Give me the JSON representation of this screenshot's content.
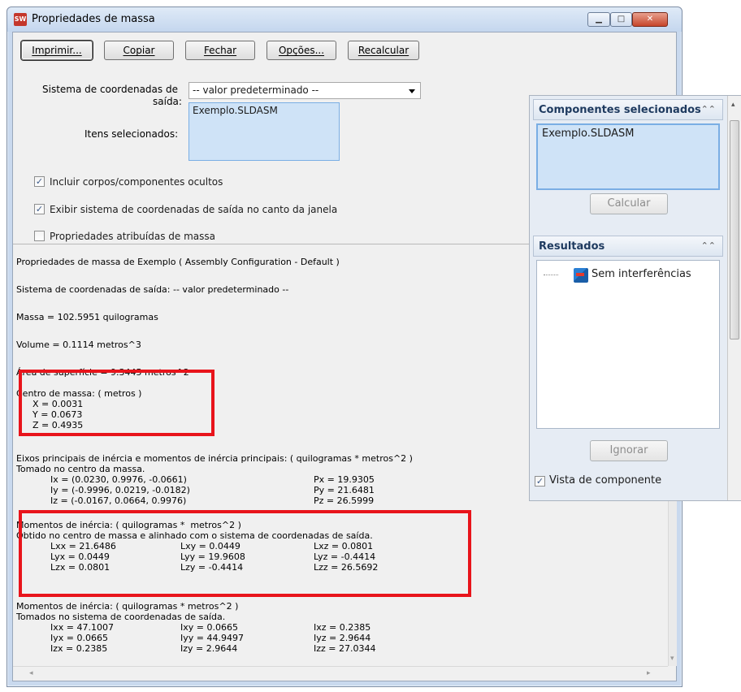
{
  "window": {
    "title": "Propriedades de massa",
    "icon_label": "SW"
  },
  "toolbar": {
    "print": "Imprimir...",
    "copy": "Copiar",
    "close": "Fechar",
    "options": "Opções...",
    "recalc": "Recalcular"
  },
  "form": {
    "coord_label_line1": "Sistema de coordenadas de",
    "coord_label_line2": "saída:",
    "coord_value": "-- valor predeterminado --",
    "items_label": "Itens selecionados:",
    "items_value": "Exemplo.SLDASM",
    "cb_hidden": "Incluir corpos/componentes ocultos",
    "cb_show_coord": "Exibir sistema de coordenadas de saída no canto da janela",
    "cb_assigned": "Propriedades atribuídas de massa"
  },
  "results": {
    "header": "Propriedades de massa de Exemplo ( Assembly Configuration - Default )",
    "coord_sys": "Sistema de coordenadas de saída: -- valor predeterminado --",
    "mass": "Massa = 102.5951 quilogramas",
    "volume": "Volume = 0.1114 metros^3",
    "area": "Área de superfície = 9.3445 metros^2",
    "com_title": "Centro de massa: ( metros )",
    "com_x": "X = 0.0031",
    "com_y": "Y = 0.0673",
    "com_z": "Z = 0.4935",
    "axes_title": "Eixos principais de inércia e momentos de inércia principais: ( quilogramas * metros^2 )",
    "axes_sub": "Tomado no centro da massa.",
    "ix": "Ix = (0.0230, 0.9976, -0.0661)",
    "iy": "Iy = (-0.9996, 0.0219, -0.0182)",
    "iz": "Iz = (-0.0167, 0.0664, 0.9976)",
    "px": "Px = 19.9305",
    "py": "Py = 21.6481",
    "pz": "Pz = 26.5999",
    "moi1_title": "Momentos de inércia: ( quilogramas *  metros^2 )",
    "moi1_sub": "Obtido no centro de massa e alinhado com o sistema de coordenadas de saída.",
    "moi1": [
      [
        "Lxx = 21.6486",
        "Lxy = 0.0449",
        "Lxz = 0.0801"
      ],
      [
        "Lyx = 0.0449",
        "Lyy = 19.9608",
        "Lyz = -0.4414"
      ],
      [
        "Lzx = 0.0801",
        "Lzy = -0.4414",
        "Lzz = 26.5692"
      ]
    ],
    "moi2_title": "Momentos de inércia: ( quilogramas * metros^2 )",
    "moi2_sub": "Tomados no sistema de coordenadas de saída.",
    "moi2": [
      [
        "Ixx = 47.1007",
        "Ixy = 0.0665",
        "Ixz = 0.2385"
      ],
      [
        "Iyx = 0.0665",
        "Iyy = 44.9497",
        "Iyz = 2.9644"
      ],
      [
        "Izx = 0.2385",
        "Izy = 2.9644",
        "Izz = 27.0344"
      ]
    ]
  },
  "side": {
    "components_title": "Componentes selecionados",
    "components_item": "Exemplo.SLDASM",
    "calc": "Calcular",
    "results_title": "Resultados",
    "tree_item": "Sem interferências",
    "ignore": "Ignorar",
    "cb_view": "Vista de componente"
  },
  "colors": {
    "highlight_box": "#e8141b",
    "selection_bg": "#cfe3f7"
  }
}
